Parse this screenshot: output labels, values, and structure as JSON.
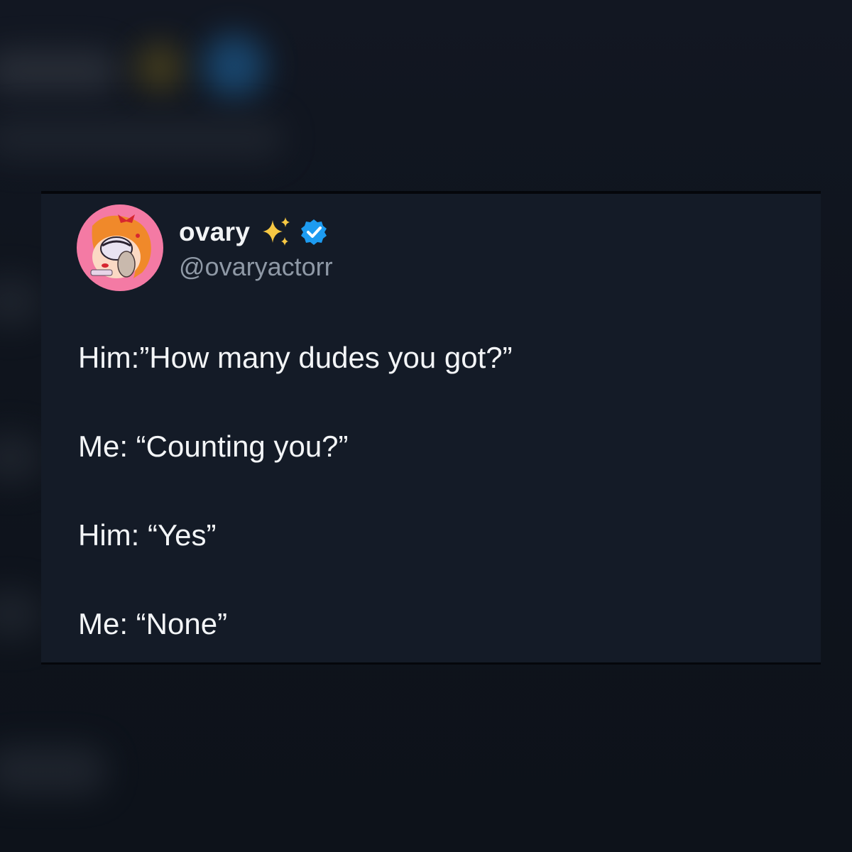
{
  "tweet": {
    "author": {
      "display_name": "ovary",
      "name_emoji": "sparkles-icon",
      "verified_badge": "verified-icon",
      "handle": "@ovaryactorr",
      "avatar": "avatar"
    },
    "lines": [
      "Him:”How many dudes you got?”",
      "Me: “Counting you?”",
      "Him: “Yes”",
      "Me: “None”"
    ]
  },
  "colors": {
    "background": "#0d121b",
    "card": "#141b27",
    "text_primary": "#f3f5f7",
    "text_secondary": "#8f99a6",
    "verified_blue": "#1d9bf0",
    "sparkle_yellow": "#f7c843",
    "avatar_pink": "#f47aa4"
  }
}
